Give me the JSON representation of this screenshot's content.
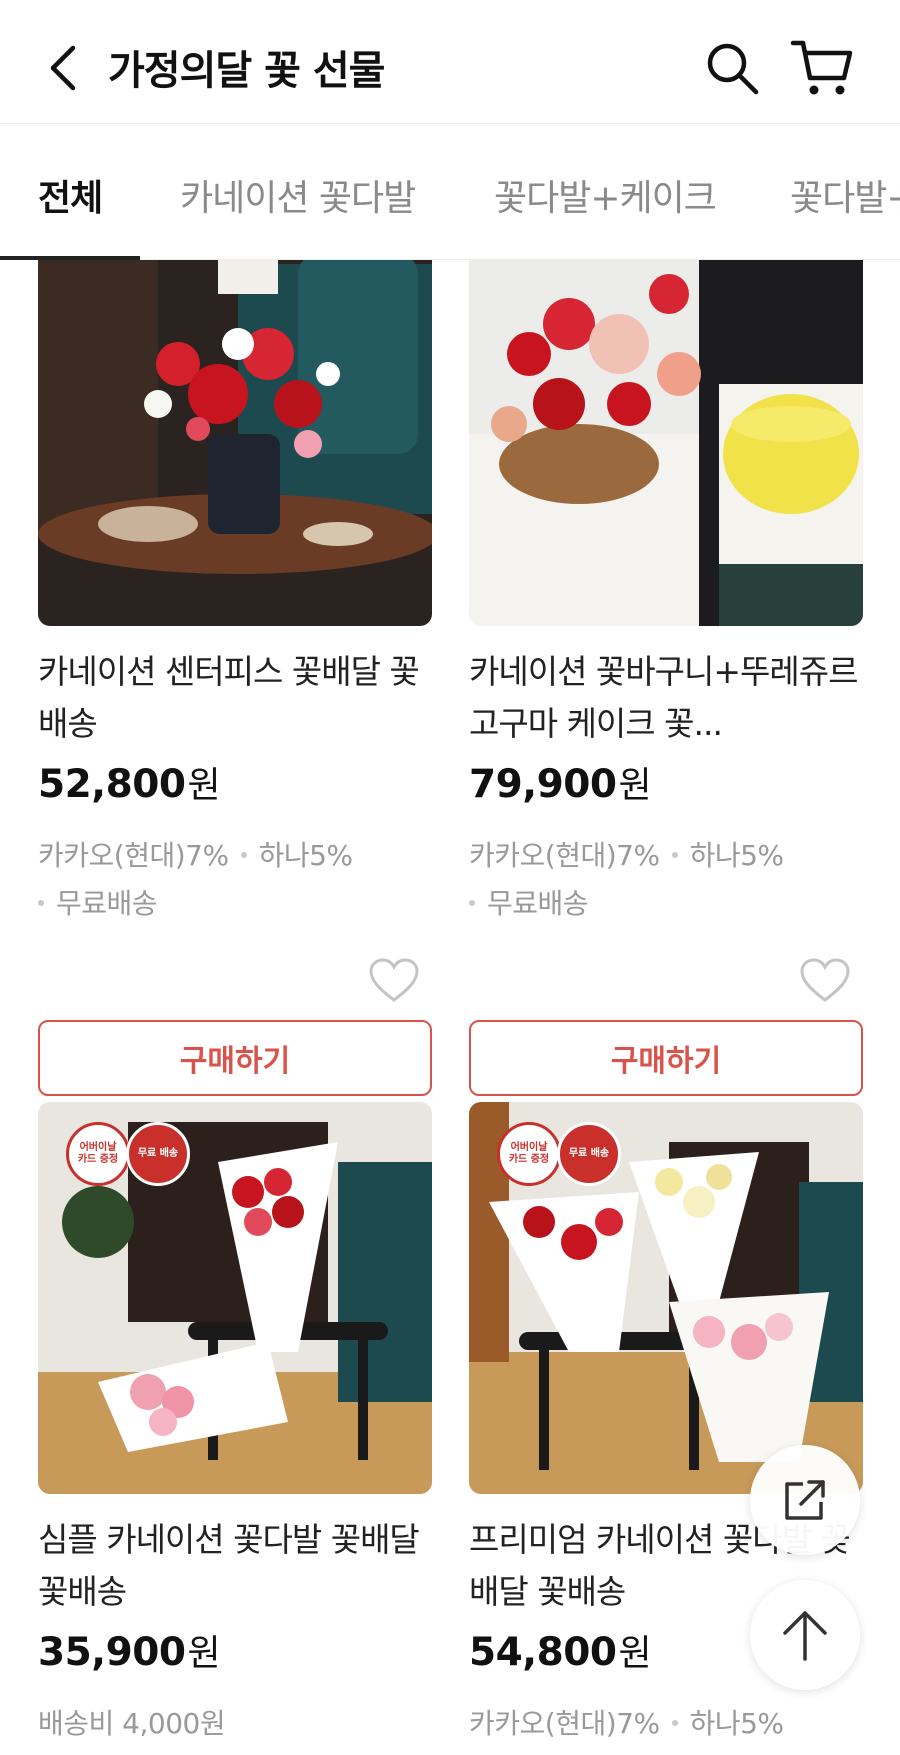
{
  "header": {
    "title": "가정의달 꽃 선물"
  },
  "tabs": [
    {
      "label": "전체"
    },
    {
      "label": "카네이션 꽃다발"
    },
    {
      "label": "꽃다발+케이크"
    },
    {
      "label": "꽃다발+"
    }
  ],
  "products": [
    {
      "name": "카네이션 센터피스 꽃배달 꽃배송",
      "price": "52,800",
      "price_unit": "원",
      "card1": "카카오(현대)7%",
      "card2": "하나5%",
      "shipping": "무료배송",
      "buy_label": "구매하기"
    },
    {
      "name": "카네이션 꽃바구니+뚜레쥬르 고구마 케이크 꽃...",
      "price": "79,900",
      "price_unit": "원",
      "card1": "카카오(현대)7%",
      "card2": "하나5%",
      "shipping": "무료배송",
      "buy_label": "구매하기"
    },
    {
      "name": "심플 카네이션 꽃다발 꽃배달 꽃배송",
      "price": "35,900",
      "price_unit": "원",
      "shipping_fee": "배송비 4,000원",
      "badge1": [
        "어버이날",
        "카드 증정"
      ],
      "badge2": "무료 배송"
    },
    {
      "name": "프리미엄 카네이션 꽃다발 꽃배달 꽃배송",
      "price": "54,800",
      "price_unit": "원",
      "card1": "카카오(현대)7%",
      "card2": "하나5%",
      "badge1": [
        "어버이날",
        "카드 증정"
      ],
      "badge2": "무료 배송"
    }
  ],
  "colors": {
    "accent": "#d9534a",
    "badge_red": "#c9302c",
    "tab_active": "#111111"
  },
  "icons": [
    "back-arrow-icon",
    "search-icon",
    "cart-icon",
    "heart-icon",
    "share-icon",
    "arrow-up-icon"
  ]
}
